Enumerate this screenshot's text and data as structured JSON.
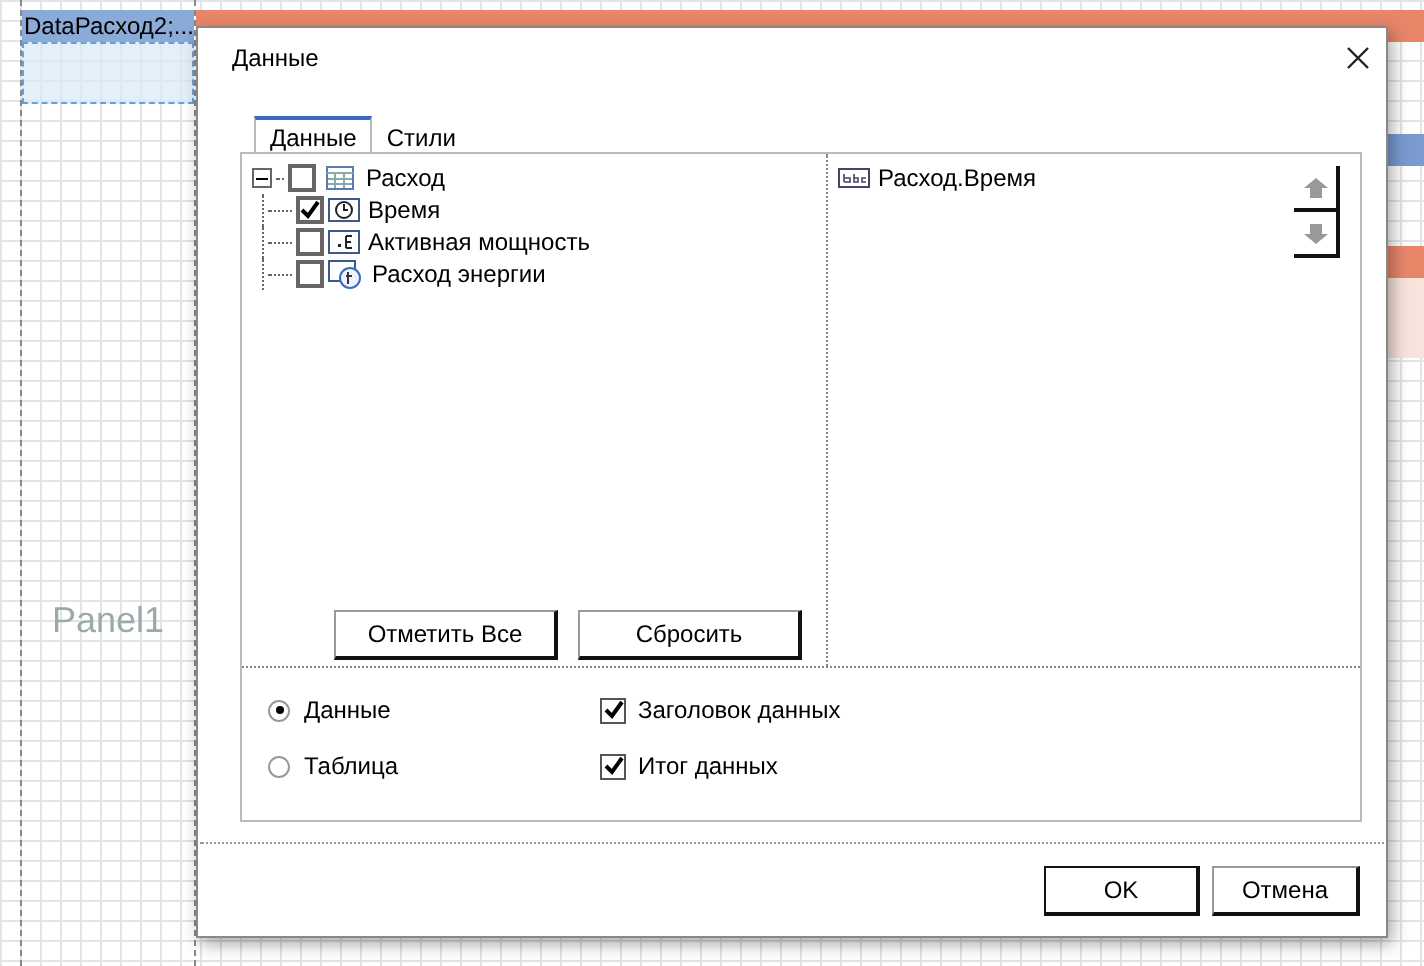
{
  "designer": {
    "band_label": "DataРасход2;...",
    "panel_label": "Panel1"
  },
  "dialog": {
    "title": "Данные",
    "tabs": [
      {
        "label": "Данные",
        "selected": true
      },
      {
        "label": "Стили",
        "selected": false
      }
    ],
    "tree": {
      "label": "Расход",
      "checked": false,
      "expanded": true,
      "children": [
        {
          "label": "Время",
          "checked": true,
          "kind": "time"
        },
        {
          "label": "Активная мощность",
          "checked": false,
          "kind": "number"
        },
        {
          "label": "Расход энергии",
          "checked": false,
          "kind": "formula"
        }
      ]
    },
    "selected_fields": [
      {
        "label": "Расход.Время"
      }
    ],
    "tree_buttons": [
      "Отметить Все",
      "Сбросить"
    ],
    "radios": [
      {
        "label": "Данные",
        "selected": true
      },
      {
        "label": "Таблица",
        "selected": false
      }
    ],
    "options": [
      {
        "label": "Заголовок данных",
        "checked": true
      },
      {
        "label": "Итог данных",
        "checked": true
      }
    ],
    "buttons": [
      "OK",
      "Отмена"
    ]
  }
}
